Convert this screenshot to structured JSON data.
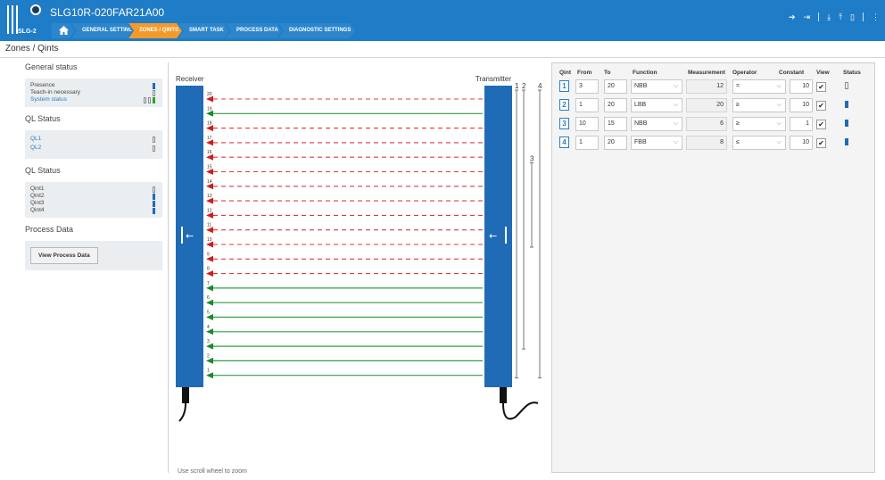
{
  "header": {
    "device_name": "SLG10R-020FAR21A00",
    "logo_text": "SLG-2",
    "nav": [
      "GENERAL SETTINGS",
      "ZONES / QINTS",
      "SMART TASK",
      "PROCESS DATA",
      "DIAGNOSTIC SETTINGS"
    ],
    "active_nav": "ZONES / QINTS",
    "icons": [
      "login-icon",
      "logout-icon",
      "download-icon",
      "upload-icon",
      "device-icon",
      "menu-icon"
    ]
  },
  "page": {
    "title": "Zones / Qints"
  },
  "sidebar": {
    "general_status": {
      "heading": "General status",
      "items": [
        {
          "label": "Presence",
          "state": "on"
        },
        {
          "label": "Teach-in necessary",
          "state": "off"
        },
        {
          "label": "System status",
          "state": "off-off-green"
        }
      ]
    },
    "ql_status_1": {
      "heading": "QL Status",
      "items": [
        {
          "label": "QL1",
          "state": "off"
        },
        {
          "label": "QL2",
          "state": "off"
        }
      ]
    },
    "ql_status_2": {
      "heading": "QL Status",
      "items": [
        {
          "label": "Qint1",
          "state": "off"
        },
        {
          "label": "Qint2",
          "state": "on"
        },
        {
          "label": "Qint3",
          "state": "on"
        },
        {
          "label": "Qint4",
          "state": "on"
        }
      ]
    },
    "process_data": {
      "heading": "Process Data",
      "button": "View Process Data"
    }
  },
  "visual": {
    "receiver_label": "Receiver",
    "transmitter_label": "Transmitter",
    "beams": [
      {
        "n": "20",
        "state": "interrupted"
      },
      {
        "n": "19",
        "state": "clear"
      },
      {
        "n": "18",
        "state": "interrupted"
      },
      {
        "n": "17",
        "state": "interrupted"
      },
      {
        "n": "16",
        "state": "interrupted"
      },
      {
        "n": "15",
        "state": "interrupted"
      },
      {
        "n": "14",
        "state": "interrupted"
      },
      {
        "n": "13",
        "state": "interrupted"
      },
      {
        "n": "12",
        "state": "interrupted"
      },
      {
        "n": "11",
        "state": "interrupted"
      },
      {
        "n": "10",
        "state": "interrupted"
      },
      {
        "n": "9",
        "state": "interrupted"
      },
      {
        "n": "8",
        "state": "interrupted"
      },
      {
        "n": "7",
        "state": "clear"
      },
      {
        "n": "6",
        "state": "clear"
      },
      {
        "n": "5",
        "state": "clear"
      },
      {
        "n": "4",
        "state": "clear"
      },
      {
        "n": "3",
        "state": "clear"
      },
      {
        "n": "2",
        "state": "clear"
      },
      {
        "n": "1",
        "state": "clear"
      }
    ],
    "zones": [
      {
        "label": "1",
        "from": 1,
        "to": 20
      },
      {
        "label": "2",
        "from": 3,
        "to": 20
      },
      {
        "label": "3",
        "from": 10,
        "to": 15
      },
      {
        "label": "4",
        "from": 1,
        "to": 20
      }
    ],
    "zoom_hint": "Use scroll wheel to zoom"
  },
  "qints": {
    "headers": [
      "Qint",
      "From",
      "To",
      "Function",
      "Measurement",
      "Operator",
      "Constant",
      "View",
      "Status"
    ],
    "rows": [
      {
        "id": "1",
        "from": "3",
        "to": "20",
        "function": "NBB",
        "measurement": "12",
        "operator": "=",
        "constant": "10",
        "view": "✔",
        "status": "off"
      },
      {
        "id": "2",
        "from": "1",
        "to": "20",
        "function": "LBB",
        "measurement": "20",
        "operator": "≥",
        "constant": "10",
        "view": "✔",
        "status": "on"
      },
      {
        "id": "3",
        "from": "10",
        "to": "15",
        "function": "NBB",
        "measurement": "6",
        "operator": "≥",
        "constant": "1",
        "view": "✔",
        "status": "on"
      },
      {
        "id": "4",
        "from": "1",
        "to": "20",
        "function": "FBB",
        "measurement": "8",
        "operator": "≤",
        "constant": "10",
        "view": "✔",
        "status": "on"
      }
    ]
  },
  "colors": {
    "topbar": "#1f7cc7",
    "active_tab": "#f39a2a",
    "sensor": "#1f6bb6",
    "beam_clear": "#2ea043",
    "beam_interrupted": "#e03b3b",
    "beam_arrow_interrupted": "#cc1f1f",
    "beam_arrow_clear": "#1a8a2e"
  }
}
